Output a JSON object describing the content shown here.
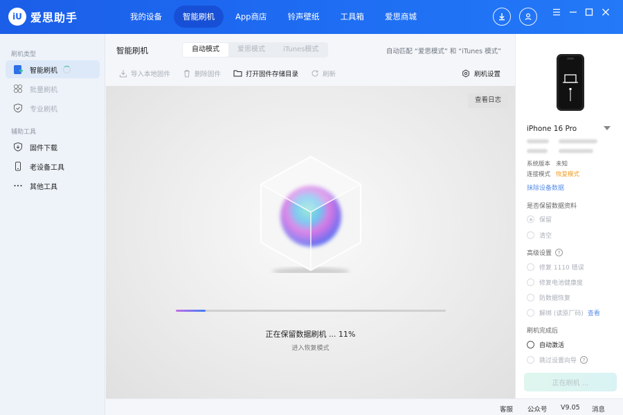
{
  "app": {
    "logo_mark": "iU",
    "name": "爱思助手"
  },
  "nav": [
    {
      "label": "我的设备",
      "active": false
    },
    {
      "label": "智能刷机",
      "active": true
    },
    {
      "label": "App商店",
      "active": false
    },
    {
      "label": "铃声壁纸",
      "active": false
    },
    {
      "label": "工具箱",
      "active": false
    },
    {
      "label": "爱思商城",
      "active": false
    }
  ],
  "icons": {
    "download": "download-icon",
    "user": "user-icon",
    "menu": "menu-icon",
    "minimize": "minimize-icon",
    "maximize": "maximize-icon",
    "close": "close-icon"
  },
  "sidebar": {
    "group1": "刷机类型",
    "items1": [
      {
        "label": "智能刷机",
        "icon": "flash-plus-icon",
        "active": true
      },
      {
        "label": "批量刷机",
        "icon": "batch-icon",
        "disabled": true
      },
      {
        "label": "专业刷机",
        "icon": "shield-check-icon",
        "disabled": true
      }
    ],
    "group2": "辅助工具",
    "items2": [
      {
        "label": "固件下载",
        "icon": "firmware-download-icon"
      },
      {
        "label": "老设备工具",
        "icon": "phone-icon"
      },
      {
        "label": "其他工具",
        "icon": "more-icon"
      }
    ]
  },
  "main": {
    "title": "智能刷机",
    "modes": [
      {
        "label": "自动模式",
        "active": true
      },
      {
        "label": "爱思模式",
        "active": false
      },
      {
        "label": "iTunes模式",
        "active": false
      }
    ],
    "auto_note": "自动匹配 “爱思模式” 和 “iTunes 模式”",
    "toolbar": {
      "import": "导入本地固件",
      "delete": "删除固件",
      "open_dir": "打开固件存储目录",
      "refresh": "刷新",
      "settings": "刷机设置"
    },
    "log_button": "查看日志",
    "progress_percent": 11,
    "status": "正在保留数据刷机 ... 11%",
    "substatus": "进入恢复模式"
  },
  "device": {
    "name": "iPhone 16 Pro",
    "rows": [
      {
        "label": "系统版本",
        "value": "未知",
        "warn": false
      },
      {
        "label": "连接模式",
        "value": "恢复模式",
        "warn": true
      }
    ],
    "erase_link": "抹除设备数据",
    "keep_data_title": "是否保留数据资料",
    "keep_options": [
      "保留",
      "清空"
    ],
    "advanced_title": "高级设置",
    "advanced_options": [
      "修复 1110 错误",
      "修复电池健康度",
      "防数据恢复",
      "解绑 (读原厂码)"
    ],
    "view_link": "查看",
    "after_title": "刷机完成后",
    "after_options": [
      "自动激活",
      "跳过设置向导"
    ],
    "flash_button": "正在刷机 ..."
  },
  "footer": {
    "service": "客服",
    "official": "公众号",
    "version": "V9.05",
    "messages": "消息"
  }
}
